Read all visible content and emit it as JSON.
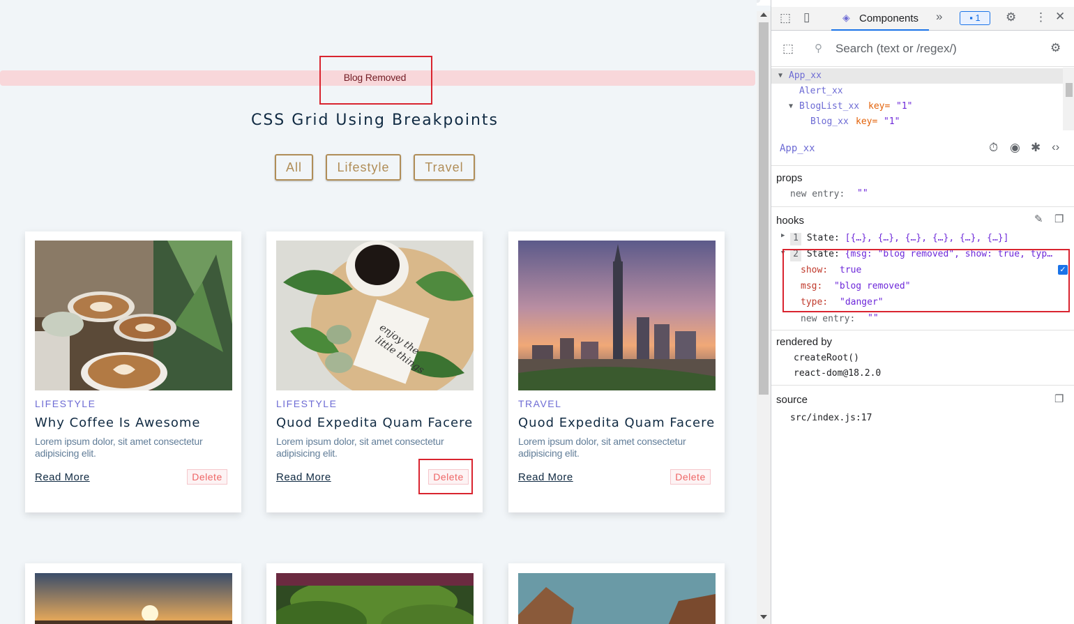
{
  "alert": {
    "text": "Blog Removed"
  },
  "page": {
    "title": "CSS Grid Using Breakpoints"
  },
  "filters": [
    "All",
    "Lifestyle",
    "Travel"
  ],
  "cards": [
    {
      "category": "LIFESTYLE",
      "title": "Why Coffee Is Awesome",
      "desc": "Lorem ipsum dolor, sit amet consectetur adipisicing elit.",
      "read_more": "Read More",
      "delete": "Delete"
    },
    {
      "category": "LIFESTYLE",
      "title": "Quod Expedita Quam Facere",
      "desc": "Lorem ipsum dolor, sit amet consectetur adipisicing elit.",
      "read_more": "Read More",
      "delete": "Delete"
    },
    {
      "category": "TRAVEL",
      "title": "Quod Expedita Quam Facere",
      "desc": "Lorem ipsum dolor, sit amet consectetur adipisicing elit.",
      "read_more": "Read More",
      "delete": "Delete"
    }
  ],
  "devtools": {
    "tab": "Components",
    "more": "»",
    "issues_count": "1",
    "search_placeholder": "Search (text or /regex/)",
    "tree": [
      {
        "name": "App_xx",
        "key": "",
        "keyval": ""
      },
      {
        "name": "Alert_xx",
        "key": "",
        "keyval": ""
      },
      {
        "name": "BlogList_xx",
        "key": "key=",
        "keyval": "\"1\""
      },
      {
        "name": "Blog_xx",
        "key": "key=",
        "keyval": "\"1\""
      }
    ],
    "selected_component": "App_xx",
    "props_title": "props",
    "props": [
      {
        "key": "new entry:",
        "value": "\"\""
      }
    ],
    "hooks_title": "hooks",
    "hooks": [
      {
        "index": "1",
        "label": "State:",
        "value": "[{…}, {…}, {…}, {…}, {…}, {…}]"
      },
      {
        "index": "2",
        "label": "State:",
        "value": "{msg: \"blog removed\", show: true, typ…"
      }
    ],
    "state_fields": [
      {
        "key": "show:",
        "value": "true"
      },
      {
        "key": "msg:",
        "value": "\"blog removed\""
      },
      {
        "key": "type:",
        "value": "\"danger\""
      }
    ],
    "hooks_new_entry": {
      "key": "new entry:",
      "value": "\"\""
    },
    "rendered_by_title": "rendered by",
    "rendered_by": [
      "createRoot()",
      "react-dom@18.2.0"
    ],
    "source_title": "source",
    "source": "src/index.js:17"
  },
  "colors": {
    "accent": "#6d6bd4",
    "brand": "#b08d57",
    "alert_bg": "#f8d7da",
    "highlight": "#d9242f"
  }
}
